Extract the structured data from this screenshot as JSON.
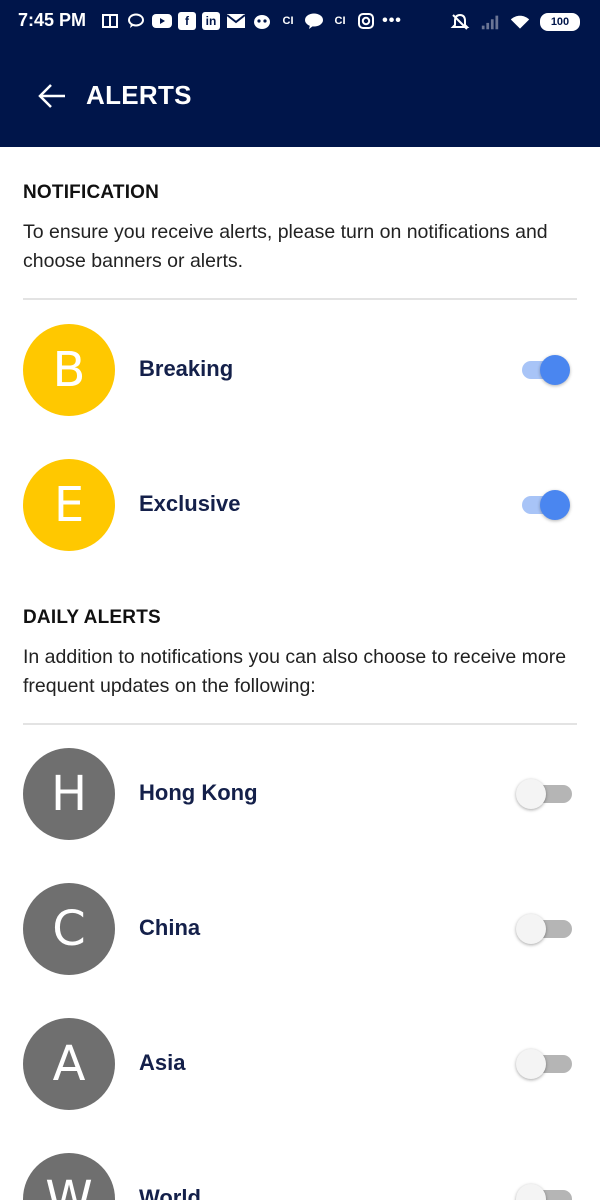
{
  "status_bar": {
    "time": "7:45 PM",
    "battery": "100",
    "left_icons": [
      "book-icon",
      "chat-bubble-icon",
      "youtube-icon",
      "flipboard-icon",
      "linkedin-icon",
      "gmail-icon",
      "mascot-icon",
      "ci-icon",
      "hkt-icon",
      "ci-icon",
      "instagram-icon",
      "more-icon"
    ],
    "right_icons": [
      "alarm-off-icon",
      "signal-icon",
      "wifi-icon",
      "battery-icon"
    ]
  },
  "app_bar": {
    "title": "ALERTS",
    "back_icon": "arrow-left-icon"
  },
  "notification": {
    "title": "NOTIFICATION",
    "description": "To ensure you receive alerts, please turn on notifications and choose banners or alerts.",
    "items": [
      {
        "letter": "B",
        "label": "Breaking",
        "enabled": true
      },
      {
        "letter": "E",
        "label": "Exclusive",
        "enabled": true
      }
    ]
  },
  "daily_alerts": {
    "title": "DAILY ALERTS",
    "description": "In addition to notifications you can also choose to receive more frequent updates on the following:",
    "items": [
      {
        "letter": "H",
        "label": "Hong Kong",
        "enabled": false
      },
      {
        "letter": "C",
        "label": "China",
        "enabled": false
      },
      {
        "letter": "A",
        "label": "Asia",
        "enabled": false
      },
      {
        "letter": "W",
        "label": "World",
        "enabled": false
      }
    ]
  },
  "colors": {
    "header_bg": "#00154a",
    "notification_avatar": "#ffc800",
    "daily_avatar": "#6f6f6f",
    "switch_on": "#4a86f0",
    "label_text": "#14204a"
  }
}
